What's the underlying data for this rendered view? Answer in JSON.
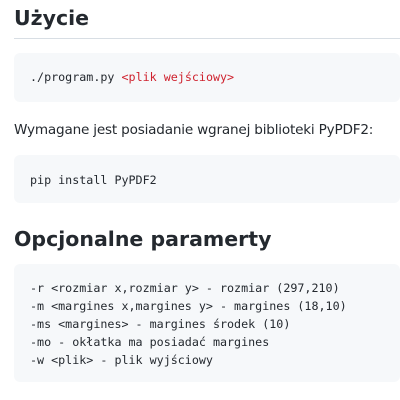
{
  "sections": {
    "usage_heading": "Użycie",
    "usage_command": "./program.py",
    "usage_argument": "<plik wejściowy>",
    "requirement_text": "Wymagane jest posiadanie wgranej biblioteki PyPDF2:",
    "install_command": "pip install PyPDF2",
    "options_heading": "Opcjonalne paramerty",
    "options_lines": [
      "-r <rozmiar x,rozmiar y> - rozmiar (297,210)",
      "-m <margines x,margines y> - margines (18,10)",
      "-ms <margines> - margines środek (10)",
      "-mo - okłatka ma posiadać margines",
      "-w <plik> - plik wyjściowy"
    ]
  },
  "colors": {
    "code_background": "#f6f8fa",
    "placeholder_text": "#cf222e",
    "heading_rule": "#d8dee4",
    "body_text": "#24292f"
  }
}
